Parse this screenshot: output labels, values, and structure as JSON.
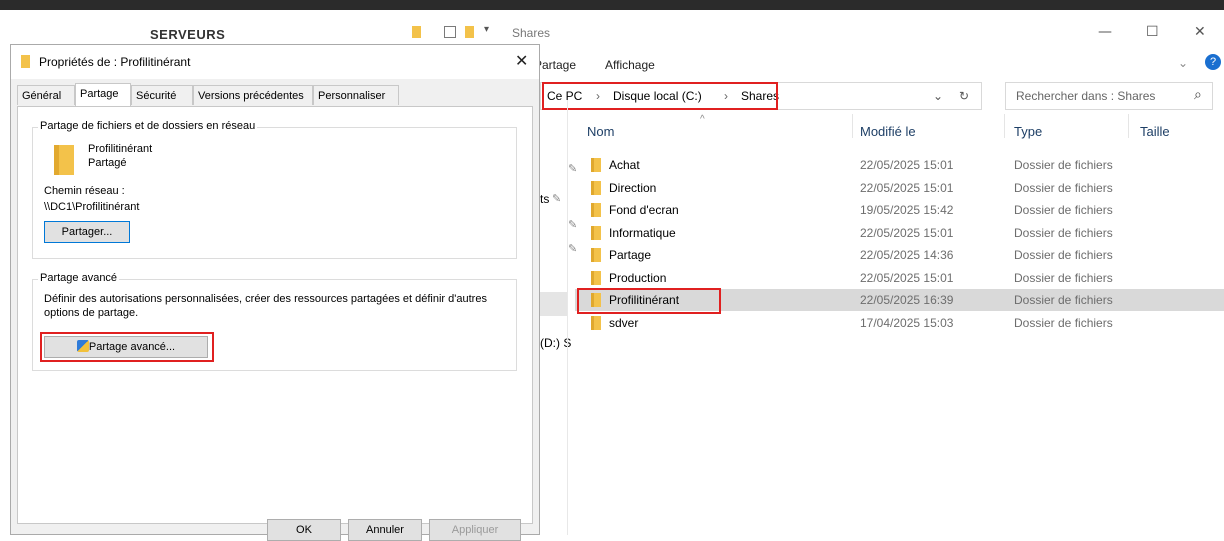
{
  "background_window": {
    "title": "SERVEURS"
  },
  "explorer": {
    "title": "Shares",
    "window_controls": {
      "minimize": "—",
      "maximize": "☐",
      "close": "✕"
    },
    "ribbon": {
      "tab_partage": "Partage",
      "tab_affichage": "Affichage"
    },
    "address": {
      "crumbs": [
        "Ce PC",
        "Disque local (C:)",
        "Shares"
      ],
      "separator": "›",
      "dropdown": "⌄",
      "refresh": "↻"
    },
    "search": {
      "placeholder": "Rechercher dans : Shares",
      "icon": "⌕"
    },
    "columns": {
      "name": "Nom",
      "modified": "Modifié le",
      "type": "Type",
      "size": "Taille"
    },
    "nav_fragments": [
      "ts",
      "(D:) S"
    ],
    "rows": [
      {
        "name": "Achat",
        "modified": "22/05/2025 15:01",
        "type": "Dossier de fichiers"
      },
      {
        "name": "Direction",
        "modified": "22/05/2025 15:01",
        "type": "Dossier de fichiers"
      },
      {
        "name": "Fond d'ecran",
        "modified": "19/05/2025 15:42",
        "type": "Dossier de fichiers"
      },
      {
        "name": "Informatique",
        "modified": "22/05/2025 15:01",
        "type": "Dossier de fichiers"
      },
      {
        "name": "Partage",
        "modified": "22/05/2025 14:36",
        "type": "Dossier de fichiers"
      },
      {
        "name": "Production",
        "modified": "22/05/2025 15:01",
        "type": "Dossier de fichiers"
      },
      {
        "name": "Profilitinérant",
        "modified": "22/05/2025 16:39",
        "type": "Dossier de fichiers",
        "selected": true
      },
      {
        "name": "sdver",
        "modified": "17/04/2025 15:03",
        "type": "Dossier de fichiers"
      }
    ]
  },
  "dialog": {
    "title": "Propriétés de : Profilitinérant",
    "close": "✕",
    "tabs": [
      "Général",
      "Partage",
      "Sécurité",
      "Versions précédentes",
      "Personnaliser"
    ],
    "active_tab": "Partage",
    "network_group": {
      "label": "Partage de fichiers et de dossiers en réseau",
      "folder_name": "Profilitinérant",
      "status": "Partagé",
      "path_label": "Chemin réseau :",
      "path_value": "\\\\DC1\\Profilitinérant",
      "share_button": "Partager..."
    },
    "advanced_group": {
      "label": "Partage avancé",
      "description_line1": "Définir des autorisations personnalisées, créer des ressources partagées et définir d'autres",
      "description_line2": "options de partage.",
      "button": "Partage avancé..."
    },
    "buttons": {
      "ok": "OK",
      "cancel": "Annuler",
      "apply": "Appliquer"
    }
  },
  "colors": {
    "highlight_red": "#e02020",
    "selection": "#d9d9d9",
    "folder": "#f3c24a"
  }
}
